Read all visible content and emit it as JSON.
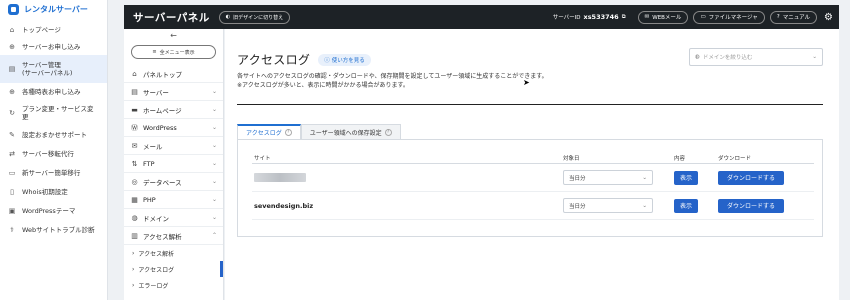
{
  "app_sidebar": {
    "brand": "レンタルサーバー",
    "items": [
      {
        "label": "トップページ",
        "icon": "home-icon"
      },
      {
        "label": "サーバーお申し込み",
        "icon": "plus-circle-icon"
      },
      {
        "label": "サーバー管理\n(サーバーパネル)",
        "icon": "server-icon"
      },
      {
        "label": "各種時表お申し込み",
        "icon": "plus-circle-icon"
      },
      {
        "label": "プラン変更・サービス変更",
        "icon": "refresh-icon"
      },
      {
        "label": "設定おまかせサポート",
        "icon": "wrench-icon"
      },
      {
        "label": "サーバー移転代行",
        "icon": "transfer-icon"
      },
      {
        "label": "新サーバー簡単移行",
        "icon": "truck-icon"
      },
      {
        "label": "Whois初期設定",
        "icon": "document-icon"
      },
      {
        "label": "WordPressテーマ",
        "icon": "theme-icon"
      },
      {
        "label": "Webサイトトラブル診断",
        "icon": "stethoscope-icon"
      }
    ]
  },
  "topbar": {
    "title": "サーバーパネル",
    "switch_label": "旧デザインに切り替え",
    "server_id_label": "サーバーID",
    "server_id": "xs533746",
    "webmail": "WEBメール",
    "file_manager": "ファイルマネージャ",
    "manual": "マニュアル"
  },
  "subnav": {
    "back": "←",
    "all_menu": "全メニュー表示",
    "items": [
      {
        "label": "パネルトップ",
        "icon": "home-icon",
        "chevron": false
      },
      {
        "label": "サーバー",
        "icon": "server-icon",
        "chevron": true
      },
      {
        "label": "ホームページ",
        "icon": "page-icon",
        "chevron": true
      },
      {
        "label": "WordPress",
        "icon": "wordpress-icon",
        "chevron": true
      },
      {
        "label": "メール",
        "icon": "mail-icon",
        "chevron": true
      },
      {
        "label": "FTP",
        "icon": "ftp-icon",
        "chevron": true
      },
      {
        "label": "データベース",
        "icon": "database-icon",
        "chevron": true
      },
      {
        "label": "PHP",
        "icon": "php-icon",
        "chevron": true
      },
      {
        "label": "ドメイン",
        "icon": "globe-icon",
        "chevron": true
      },
      {
        "label": "アクセス解析",
        "icon": "chart-icon",
        "chevron": true
      }
    ],
    "sub_items": [
      {
        "label": "アクセス解析"
      },
      {
        "label": "アクセスログ"
      },
      {
        "label": "エラーログ"
      }
    ]
  },
  "main": {
    "title": "アクセスログ",
    "help_label": "使い方を見る",
    "domain_placeholder": "ドメインを絞り込む",
    "desc_line1": "各サイトへのアクセスログの確認・ダウンロードや、保存期間を設定してユーザー領域に生成することができます。",
    "desc_line2": "※アクセスログが多いと、表示に時間がかかる場合があります。",
    "tabs": [
      {
        "label": "アクセスログ"
      },
      {
        "label": "ユーザー領域への保存設定"
      }
    ],
    "table": {
      "headers": [
        "サイト",
        "対象日",
        "内容",
        "ダウンロード"
      ],
      "rows": [
        {
          "site": "",
          "date": "当日分",
          "view": "表示",
          "download": "ダウンロードする"
        },
        {
          "site": "sevendesign.biz",
          "date": "当日分",
          "view": "表示",
          "download": "ダウンロードする"
        }
      ]
    }
  },
  "colors": {
    "accent": "#2563c9",
    "topbar_bg": "#1d2226"
  }
}
